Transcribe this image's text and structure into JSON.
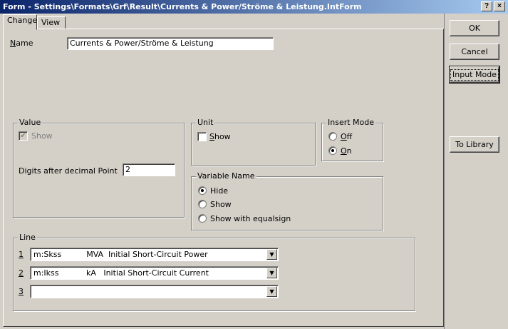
{
  "window": {
    "title": "Form - Settings\\Formats\\Grf\\Result\\Currents & Power/Ströme & Leistung.IntForm",
    "help_label": "?",
    "close_label": "×"
  },
  "tabs": [
    {
      "label": "Change",
      "active": true
    },
    {
      "label": "View",
      "active": false
    }
  ],
  "name": {
    "label": "Name",
    "value": "Currents & Power/Ströme & Leistung"
  },
  "value_group": {
    "legend": "Value",
    "show_label": "Show",
    "show_checked": true,
    "digits_label": "Digits after decimal Point",
    "digits_value": "2"
  },
  "unit_group": {
    "legend": "Unit",
    "show_label": "Show",
    "show_checked": false
  },
  "insert_mode": {
    "legend": "Insert Mode",
    "options": [
      {
        "label": "Off",
        "selected": false
      },
      {
        "label": "On",
        "selected": true
      }
    ]
  },
  "variable_name": {
    "legend": "Variable Name",
    "options": [
      {
        "label": "Hide",
        "selected": true
      },
      {
        "label": "Show",
        "selected": false
      },
      {
        "label": "Show with equalsign",
        "selected": false
      }
    ]
  },
  "line_group": {
    "legend": "Line",
    "rows": [
      {
        "num": "1",
        "value": "m:Skss          MVA  Initial Short-Circuit Power"
      },
      {
        "num": "2",
        "value": "m:Ikss           kA   Initial Short-Circuit Current"
      },
      {
        "num": "3",
        "value": ""
      }
    ]
  },
  "buttons": {
    "ok": "OK",
    "cancel": "Cancel",
    "input_mode": "Input Mode",
    "to_library": "To Library"
  },
  "icons": {
    "dropdown": "▼",
    "check": "✔"
  }
}
